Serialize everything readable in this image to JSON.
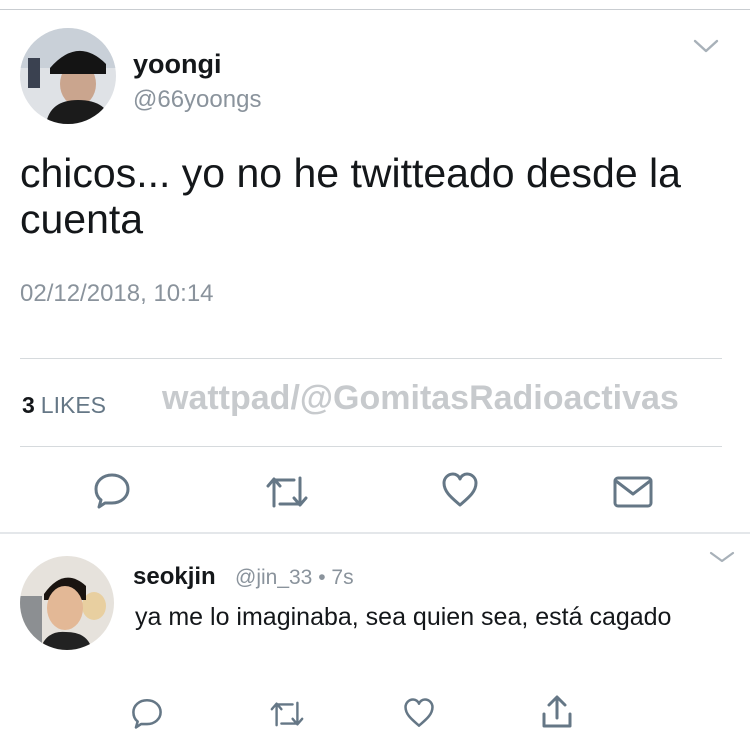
{
  "tweet": {
    "author_name": "yoongi",
    "author_handle": "@66yoongs",
    "text": "chicos... yo no he twitteado desde la cuenta",
    "timestamp": "02/12/2018, 10:14",
    "likes_count": "3",
    "likes_label": "LIKES",
    "actions": [
      "reply-icon",
      "retweet-icon",
      "like-icon",
      "message-icon"
    ]
  },
  "watermark": "wattpad/@GomitasRadioactivas",
  "reply": {
    "author_name": "seokjin",
    "author_handle": "@jin_33",
    "separator": "•",
    "time": "7s",
    "text": "ya me lo imaginaba, sea quien sea, está cagado",
    "actions": [
      "reply-icon",
      "retweet-icon",
      "like-icon",
      "share-icon"
    ]
  },
  "colors": {
    "text": "#14171a",
    "secondary": "#8a939c",
    "icon": "#657786",
    "watermark": "#c7cacd",
    "divider": "#d6dadd"
  }
}
